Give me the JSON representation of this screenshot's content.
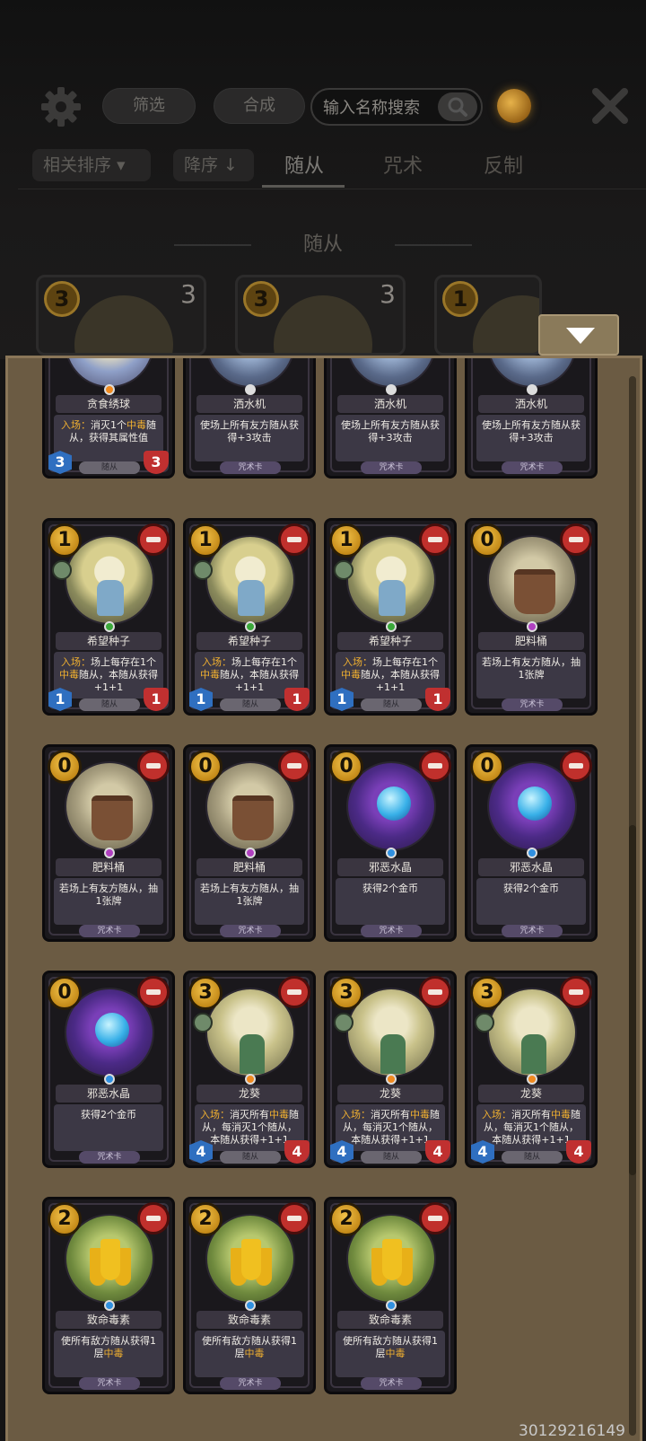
{
  "toolbar": {
    "filter_label": "筛选",
    "compose_label": "合成",
    "search_placeholder": "输入名称搜索"
  },
  "sort": {
    "relevance_label": "相关排序 ▾",
    "order_label": "降序 ↓"
  },
  "tabs": [
    {
      "label": "随从",
      "active": true
    },
    {
      "label": "咒术",
      "active": false
    },
    {
      "label": "反制",
      "active": false
    }
  ],
  "section_title": "随从",
  "deck_preview": [
    {
      "cost": "3",
      "count": "3"
    },
    {
      "cost": "3",
      "count": "3"
    },
    {
      "cost": "1",
      "count": ""
    }
  ],
  "cards": [
    {
      "name": "贪食绣球",
      "gem": "orange",
      "art": "girl2",
      "desc_pre": "入场：",
      "desc": "消灭1个中毒随从，获得其属性值",
      "tag": "随从",
      "atk": "3",
      "hp": "3",
      "cost": "",
      "partial": true
    },
    {
      "name": "洒水机",
      "gem": "white",
      "art": "sprinkler",
      "desc_pre": "",
      "desc": "使场上所有友方随从获得+3攻击",
      "tag": "咒术卡",
      "atk": "",
      "hp": "",
      "cost": "",
      "partial": true
    },
    {
      "name": "洒水机",
      "gem": "white",
      "art": "sprinkler",
      "desc_pre": "",
      "desc": "使场上所有友方随从获得+3攻击",
      "tag": "咒术卡",
      "atk": "",
      "hp": "",
      "cost": "",
      "partial": true
    },
    {
      "name": "洒水机",
      "gem": "white",
      "art": "sprinkler",
      "desc_pre": "",
      "desc": "使场上所有友方随从获得+3攻击",
      "tag": "咒术卡",
      "atk": "",
      "hp": "",
      "cost": "",
      "partial": true
    },
    {
      "name": "希望种子",
      "gem": "green",
      "art": "girl",
      "desc_pre": "入场：",
      "desc": "场上每存在1个中毒随从，本随从获得+1+1",
      "tag": "随从",
      "atk": "1",
      "hp": "1",
      "cost": "1"
    },
    {
      "name": "希望种子",
      "gem": "green",
      "art": "girl",
      "desc_pre": "入场：",
      "desc": "场上每存在1个中毒随从，本随从获得+1+1",
      "tag": "随从",
      "atk": "1",
      "hp": "1",
      "cost": "1"
    },
    {
      "name": "希望种子",
      "gem": "green",
      "art": "girl",
      "desc_pre": "入场：",
      "desc": "场上每存在1个中毒随从，本随从获得+1+1",
      "tag": "随从",
      "atk": "1",
      "hp": "1",
      "cost": "1"
    },
    {
      "name": "肥料桶",
      "gem": "purple",
      "art": "bucket",
      "desc_pre": "",
      "desc": "若场上有友方随从，抽1张牌",
      "tag": "咒术卡",
      "atk": "",
      "hp": "",
      "cost": "0"
    },
    {
      "name": "肥料桶",
      "gem": "purple",
      "art": "bucket",
      "desc_pre": "",
      "desc": "若场上有友方随从，抽1张牌",
      "tag": "咒术卡",
      "atk": "",
      "hp": "",
      "cost": "0"
    },
    {
      "name": "肥料桶",
      "gem": "purple",
      "art": "bucket",
      "desc_pre": "",
      "desc": "若场上有友方随从，抽1张牌",
      "tag": "咒术卡",
      "atk": "",
      "hp": "",
      "cost": "0"
    },
    {
      "name": "邪恶水晶",
      "gem": "blue",
      "art": "crystal",
      "desc_pre": "",
      "desc": "获得2个金币",
      "tag": "咒术卡",
      "atk": "",
      "hp": "",
      "cost": "0"
    },
    {
      "name": "邪恶水晶",
      "gem": "blue",
      "art": "crystal",
      "desc_pre": "",
      "desc": "获得2个金币",
      "tag": "咒术卡",
      "atk": "",
      "hp": "",
      "cost": "0"
    },
    {
      "name": "邪恶水晶",
      "gem": "blue",
      "art": "crystal",
      "desc_pre": "",
      "desc": "获得2个金币",
      "tag": "咒术卡",
      "atk": "",
      "hp": "",
      "cost": "0"
    },
    {
      "name": "龙葵",
      "gem": "orange",
      "art": "dragon",
      "desc_pre": "入场：",
      "desc": "消灭所有中毒随从，每消灭1个随从，本随从获得+1+1",
      "tag": "随从",
      "atk": "4",
      "hp": "4",
      "cost": "3"
    },
    {
      "name": "龙葵",
      "gem": "orange",
      "art": "dragon",
      "desc_pre": "入场：",
      "desc": "消灭所有中毒随从，每消灭1个随从，本随从获得+1+1",
      "tag": "随从",
      "atk": "4",
      "hp": "4",
      "cost": "3"
    },
    {
      "name": "龙葵",
      "gem": "orange",
      "art": "dragon",
      "desc_pre": "入场：",
      "desc": "消灭所有中毒随从，每消灭1个随从，本随从获得+1+1",
      "tag": "随从",
      "atk": "4",
      "hp": "4",
      "cost": "3"
    },
    {
      "name": "致命毒素",
      "gem": "blue",
      "art": "flower",
      "desc_pre": "",
      "desc": "使所有敌方随从获得1层中毒",
      "tag": "咒术卡",
      "atk": "",
      "hp": "",
      "cost": "2"
    },
    {
      "name": "致命毒素",
      "gem": "blue",
      "art": "flower",
      "desc_pre": "",
      "desc": "使所有敌方随从获得1层中毒",
      "tag": "咒术卡",
      "atk": "",
      "hp": "",
      "cost": "2"
    },
    {
      "name": "致命毒素",
      "gem": "blue",
      "art": "flower",
      "desc_pre": "",
      "desc": "使所有敌方随从获得1层中毒",
      "tag": "咒术卡",
      "atk": "",
      "hp": "",
      "cost": "2"
    }
  ],
  "keyword": "中毒",
  "footer_id": "30129216149"
}
